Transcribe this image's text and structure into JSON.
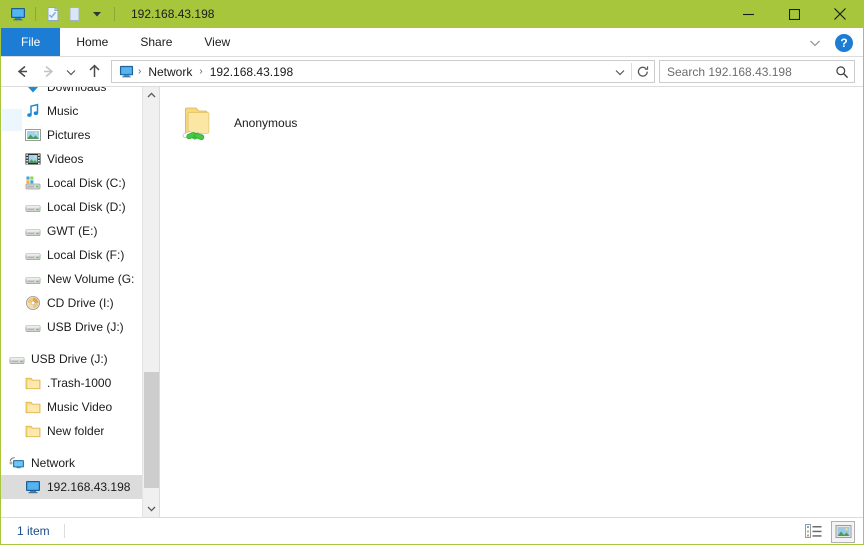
{
  "window": {
    "title": "192.168.43.198",
    "accent_color": "#a8c63c",
    "file_tab_color": "#1d7dd4"
  },
  "quick_access_toolbar": {
    "items": [
      {
        "name": "computer-icon",
        "label": "192.168.43.198"
      },
      {
        "name": "properties-icon",
        "label": "Properties"
      },
      {
        "name": "new-folder-icon",
        "label": "New folder"
      },
      {
        "name": "customize-chevron-icon",
        "label": "Customize Quick Access Toolbar"
      }
    ]
  },
  "window_controls": {
    "minimize": "—",
    "maximize": "☐",
    "close": "✕"
  },
  "ribbon": {
    "tabs": [
      {
        "label": "File",
        "selected": true
      },
      {
        "label": "Home",
        "selected": false
      },
      {
        "label": "Share",
        "selected": false
      },
      {
        "label": "View",
        "selected": false
      }
    ],
    "collapse_label": "Minimize the Ribbon",
    "help_label": "?"
  },
  "navigation": {
    "back_label": "Back",
    "forward_label": "Forward",
    "recent_label": "Recent locations",
    "up_label": "Up"
  },
  "address_bar": {
    "crumbs": [
      {
        "label": "Network"
      },
      {
        "label": "192.168.43.198"
      }
    ],
    "separator": "›",
    "dropdown_label": "Previous locations",
    "refresh_label": "Refresh"
  },
  "search": {
    "placeholder": "Search 192.168.43.198",
    "value": ""
  },
  "sidebar": {
    "items": [
      {
        "label": "Downloads",
        "icon": "downloads-icon",
        "level": 1,
        "selected": false
      },
      {
        "label": "Music",
        "icon": "music-icon",
        "level": 1,
        "selected": false
      },
      {
        "label": "Pictures",
        "icon": "pictures-icon",
        "level": 1,
        "selected": false
      },
      {
        "label": "Videos",
        "icon": "videos-icon",
        "level": 1,
        "selected": false
      },
      {
        "label": "Local Disk (C:)",
        "icon": "system-disk-icon",
        "level": 1,
        "selected": false
      },
      {
        "label": "Local Disk (D:)",
        "icon": "drive-icon",
        "level": 1,
        "selected": false
      },
      {
        "label": "GWT (E:)",
        "icon": "drive-icon",
        "level": 1,
        "selected": false
      },
      {
        "label": "Local Disk (F:)",
        "icon": "drive-icon",
        "level": 1,
        "selected": false
      },
      {
        "label": "New Volume (G:",
        "icon": "drive-icon",
        "level": 1,
        "selected": false
      },
      {
        "label": "CD Drive (I:)",
        "icon": "cd-drive-icon",
        "level": 1,
        "selected": false
      },
      {
        "label": "USB Drive (J:)",
        "icon": "drive-icon",
        "level": 1,
        "selected": false
      },
      {
        "label": "USB Drive (J:)",
        "icon": "drive-icon",
        "level": 0,
        "selected": false,
        "spacer_before": true
      },
      {
        "label": ".Trash-1000",
        "icon": "folder-icon",
        "level": 1,
        "selected": false
      },
      {
        "label": "Music Video",
        "icon": "folder-icon",
        "level": 1,
        "selected": false
      },
      {
        "label": "New folder",
        "icon": "folder-icon",
        "level": 1,
        "selected": false
      },
      {
        "label": "Network",
        "icon": "network-icon",
        "level": 0,
        "selected": false,
        "spacer_before": true
      },
      {
        "label": "192.168.43.198",
        "icon": "computer-icon",
        "level": 1,
        "selected": true
      }
    ]
  },
  "content": {
    "items": [
      {
        "name": "Anonymous",
        "icon": "shared-folder-icon"
      }
    ]
  },
  "status_bar": {
    "item_count": "1 item",
    "views": [
      {
        "name": "details-view-button",
        "label": "Details",
        "active": false
      },
      {
        "name": "large-icons-view-button",
        "label": "Large icons",
        "active": true
      }
    ]
  }
}
